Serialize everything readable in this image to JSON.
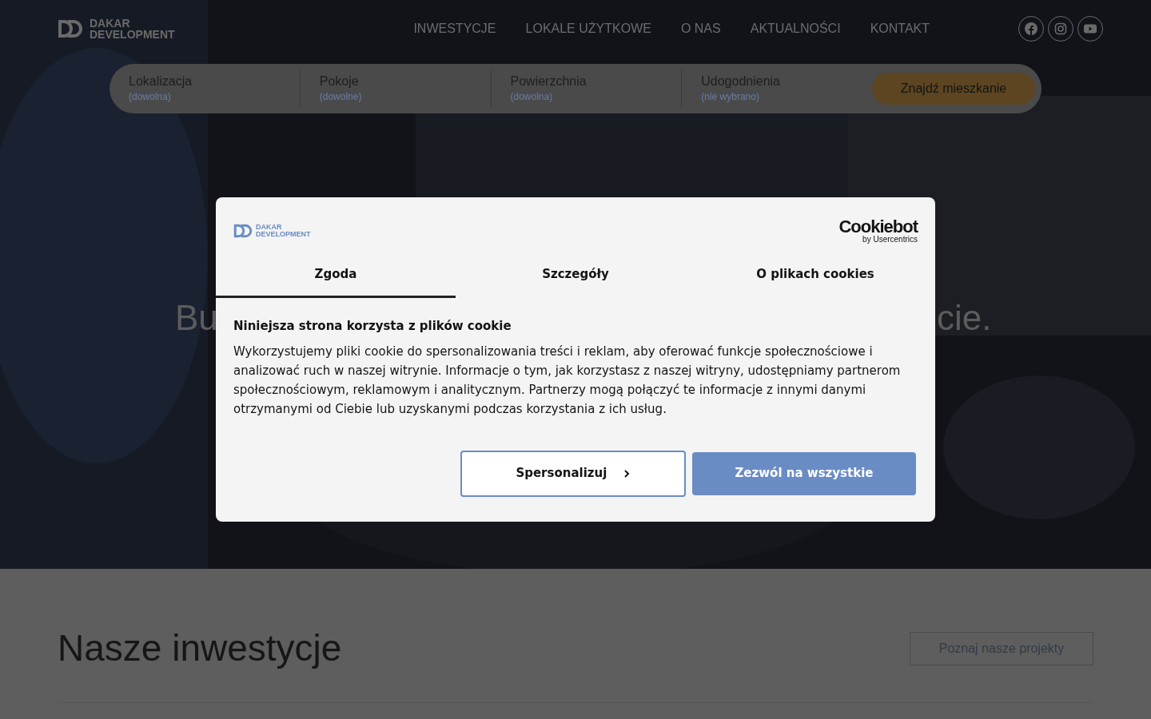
{
  "header": {
    "logo": {
      "line_1": "DAKAR",
      "line_2": "DEVELOPMENT"
    },
    "nav": [
      "INWESTYCJE",
      "LOKALE UŻYTKOWE",
      "O NAS",
      "AKTUALNOŚCI",
      "KONTAKT"
    ],
    "social": [
      {
        "kind": "facebook"
      },
      {
        "kind": "instagram"
      },
      {
        "kind": "youtube"
      }
    ]
  },
  "search": {
    "filters": [
      {
        "label": "Lokalizacja",
        "value": "(dowolna)"
      },
      {
        "label": "Pokoje",
        "value": "(dowolne)"
      },
      {
        "label": "Powierzchnia",
        "value": "(dowolna)"
      },
      {
        "label": "Udogodnienia",
        "value": "(nie wybrano)"
      }
    ],
    "button": "Znajdź mieszkanie"
  },
  "hero": {
    "heading_left": "Bu",
    "heading_right": "cie."
  },
  "section": {
    "title": "Nasze inwestycje",
    "button": "Poznaj nasze projekty"
  },
  "cookie_dialog": {
    "logo": {
      "line_1": "DAKAR",
      "line_2": "DEVELOPMENT"
    },
    "provider": {
      "name": "Cookiebot",
      "by": "by Usercentrics"
    },
    "tabs": [
      {
        "label": "Zgoda",
        "selected": true
      },
      {
        "label": "Szczegóły",
        "selected": false
      },
      {
        "label": "O plikach cookies",
        "selected": false
      }
    ],
    "title": "Niniejsza strona korzysta z plików cookie",
    "text": "Wykorzystujemy pliki cookie do spersonalizowania treści i reklam, aby oferować funkcje społecznościowe i analizować ruch w naszej witrynie. Informacje o tym, jak korzystasz z naszej witryny, udostępniamy partnerom społecznościowym, reklamowym i analitycznym. Partnerzy mogą połączyć te informacje z innymi danymi otrzymanymi od Ciebie lub uzyskanymi podczas korzystania z ich usług.",
    "buttons": [
      {
        "kind": "outline",
        "label": "Spersonalizuj"
      },
      {
        "kind": "primary",
        "label": "Zezwól na wszystkie"
      }
    ]
  }
}
